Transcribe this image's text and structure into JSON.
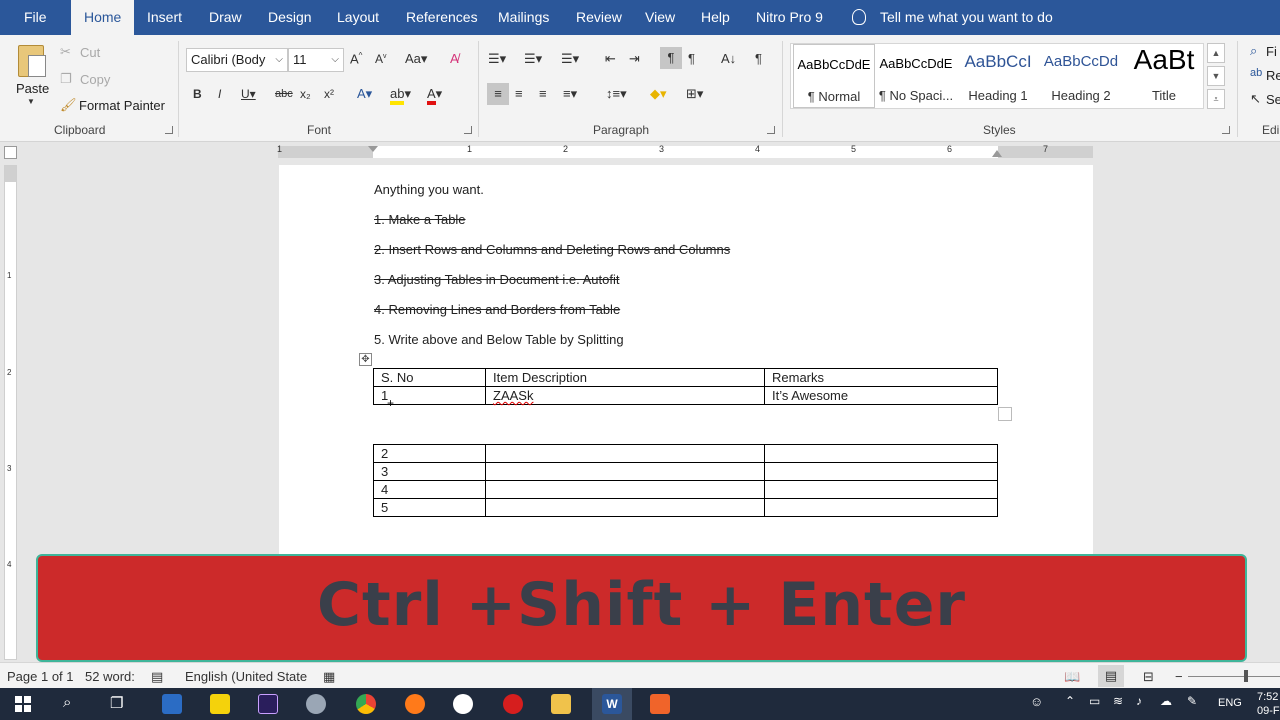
{
  "tabs": [
    {
      "label": "File",
      "x": 24
    },
    {
      "label": "Home",
      "active": true
    },
    {
      "label": "Insert"
    },
    {
      "label": "Draw"
    },
    {
      "label": "Design"
    },
    {
      "label": "Layout"
    },
    {
      "label": "References"
    },
    {
      "label": "Mailings"
    },
    {
      "label": "Review"
    },
    {
      "label": "View"
    },
    {
      "label": "Help"
    },
    {
      "label": "Nitro Pro 9"
    }
  ],
  "tell_me": "Tell me what you want to do",
  "clipboard": {
    "paste": "Paste",
    "cut": "Cut",
    "copy": "Copy",
    "format_painter": "Format Painter",
    "group": "Clipboard"
  },
  "font": {
    "family": "Calibri (Body",
    "size": "11",
    "group": "Font"
  },
  "paragraph": {
    "group": "Paragraph"
  },
  "styles": {
    "group": "Styles",
    "items": [
      {
        "sample": "AaBbCcDdE",
        "name": "¶ Normal",
        "selected": true
      },
      {
        "sample": "AaBbCcDdE",
        "name": "¶ No Spaci..."
      },
      {
        "sample": "AaBbCcI",
        "name": "Heading 1"
      },
      {
        "sample": "AaBbCcDd",
        "name": "Heading 2"
      },
      {
        "sample": "AaBt",
        "name": "Title"
      }
    ]
  },
  "editing": {
    "find": "Fi",
    "replace": "Re",
    "select": "Se",
    "group": "Edi"
  },
  "ruler": {
    "numbers": [
      "1",
      "1",
      "2",
      "3",
      "4",
      "5",
      "6",
      "7"
    ]
  },
  "vruler": {
    "numbers": [
      "1",
      "2",
      "3",
      "4"
    ]
  },
  "document": {
    "lines": [
      {
        "text": "Anything you want.",
        "strike": false
      },
      {
        "text": "1. Make a Table",
        "strike": true
      },
      {
        "text": "2. Insert Rows and Columns and Deleting Rows and Columns",
        "strike": true
      },
      {
        "text": "3. Adjusting Tables in Document i.e. Autofit",
        "strike": true
      },
      {
        "text": "4. Removing Lines and Borders from Table",
        "strike": true
      },
      {
        "text": "5. Write above and Below Table by Splitting",
        "strike": false
      }
    ],
    "table1": {
      "header": [
        "S. No",
        "Item Description",
        "Remarks"
      ],
      "rows": [
        [
          "1",
          "ZAASk",
          "It’s Awesome"
        ]
      ]
    },
    "table2": {
      "rows": [
        [
          "2",
          "",
          ""
        ],
        [
          "3",
          "",
          ""
        ],
        [
          "4",
          "",
          ""
        ],
        [
          "5",
          "",
          ""
        ]
      ]
    }
  },
  "banner": {
    "text": "Ctrl +Shift + Enter",
    "bg": "#cc2a2a",
    "text_color": "#3a3f4a"
  },
  "status": {
    "page": "Page 1 of 1",
    "words": "52 word:",
    "language": "English (United State"
  },
  "taskbar": {
    "lang": "ENG",
    "time": "7:52",
    "date": "09-F"
  },
  "colors": {
    "ribbon_blue": "#2b579a",
    "ribbon_bg": "#f3f3f3",
    "page_bg": "#ffffff",
    "taskbar": "#1f2a3c"
  }
}
